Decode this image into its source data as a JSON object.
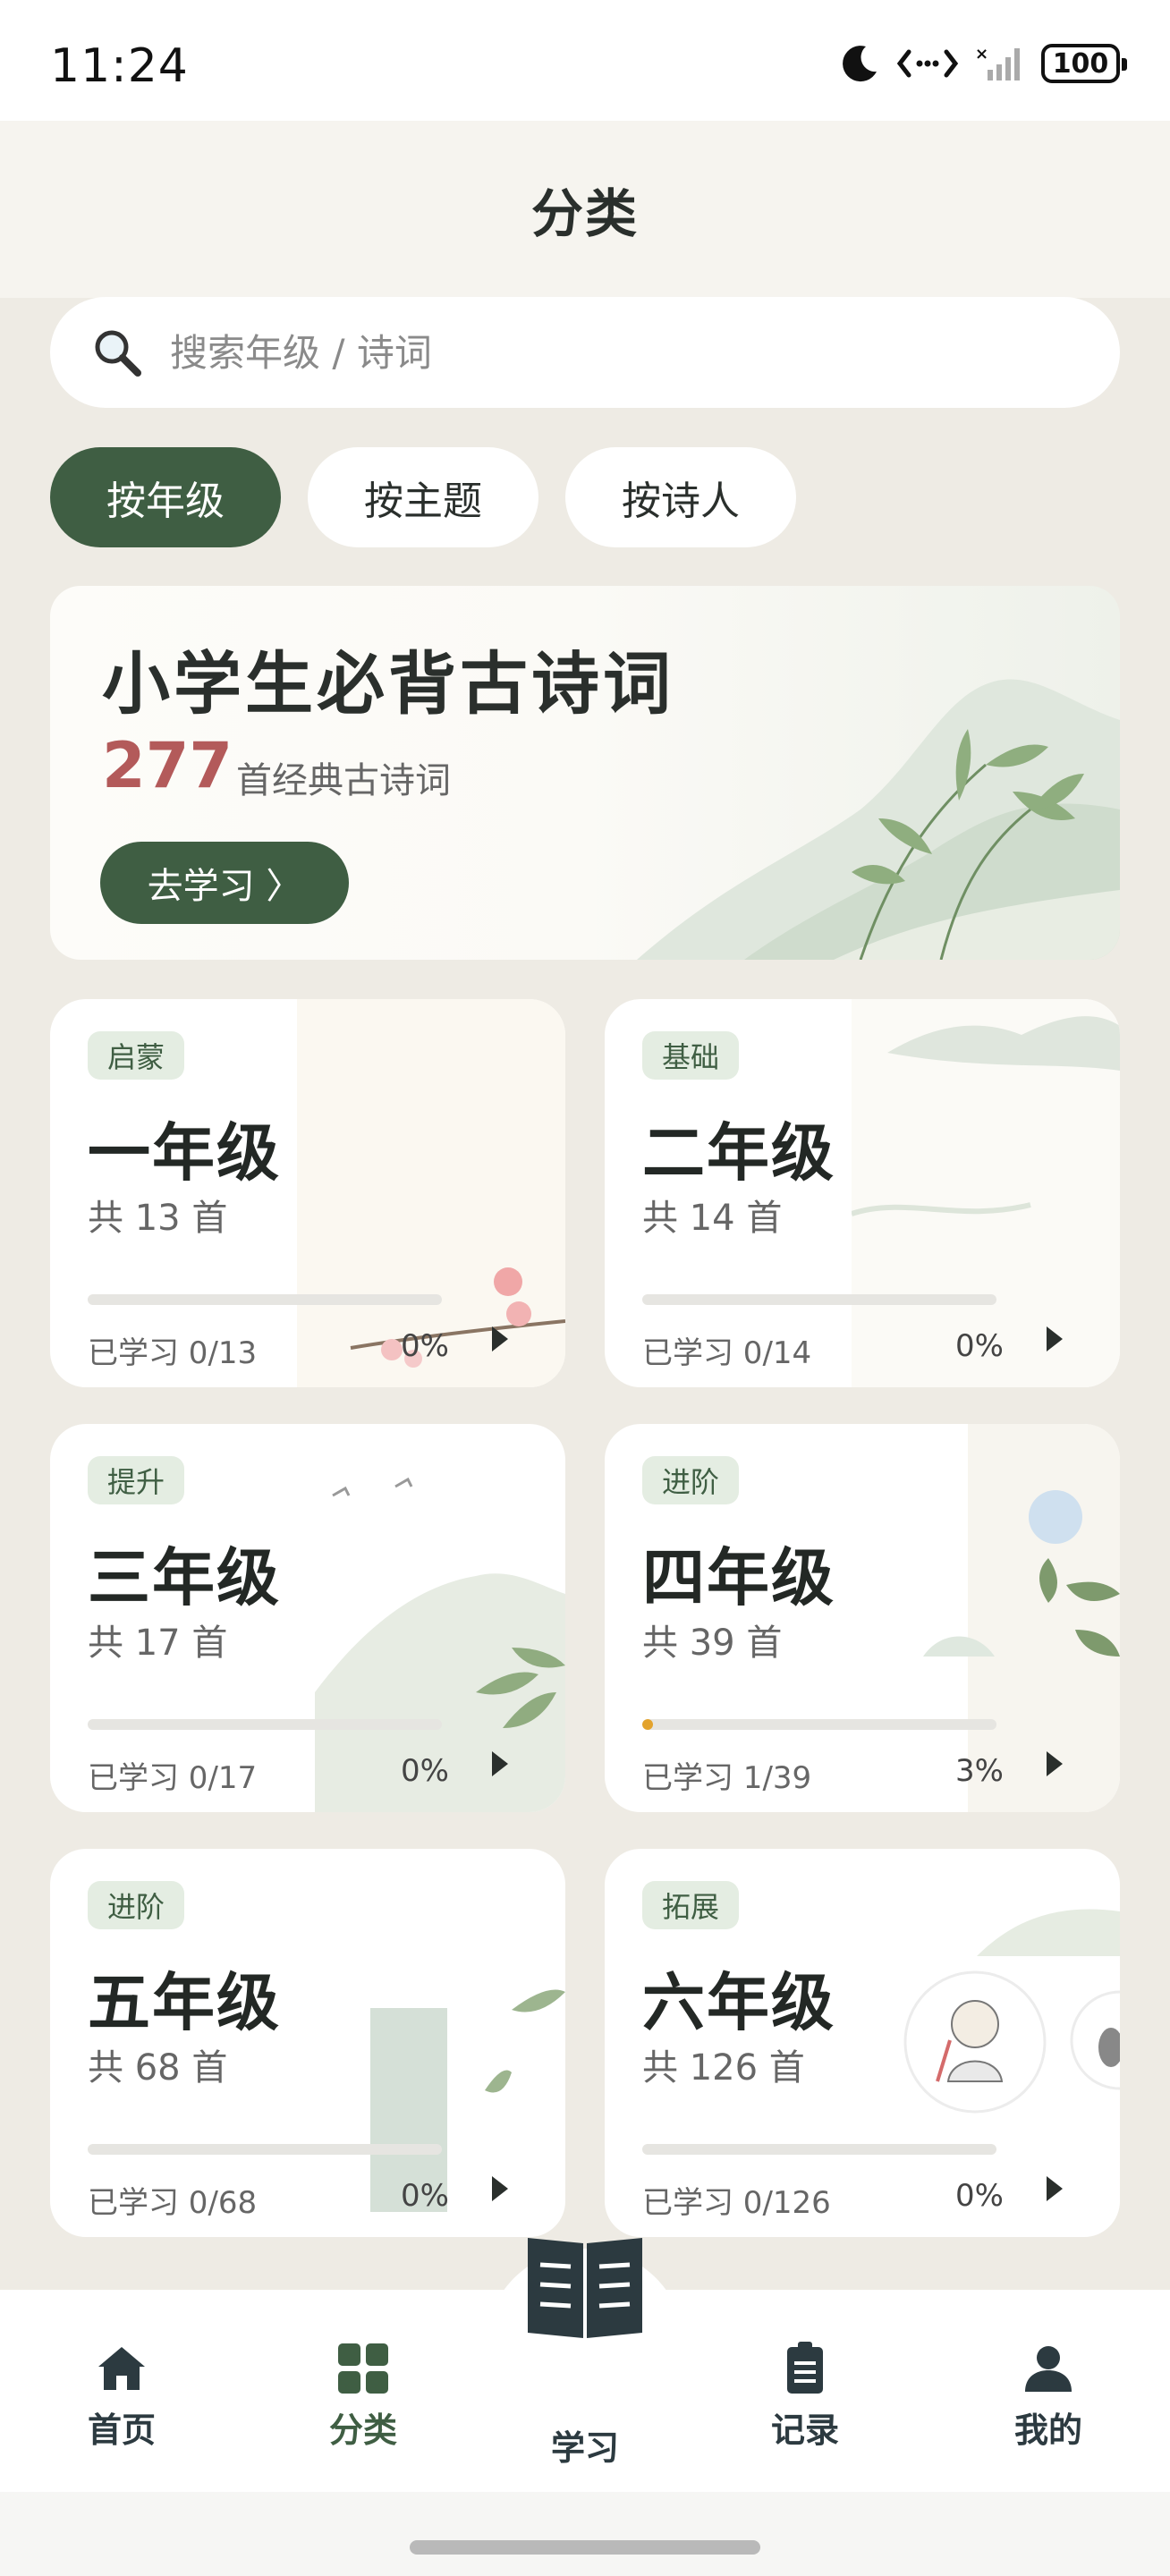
{
  "status_bar": {
    "time": "11:24",
    "battery": "100",
    "icons": [
      "moon-icon",
      "data-transfer-icon",
      "signal-icon",
      "battery-icon"
    ]
  },
  "header": {
    "title": "分类"
  },
  "search": {
    "placeholder": "搜索年级 / 诗词",
    "value": ""
  },
  "filter_tabs": [
    {
      "label": "按年级",
      "active": true
    },
    {
      "label": "按主题",
      "active": false
    },
    {
      "label": "按诗人",
      "active": false
    }
  ],
  "hero": {
    "title": "小学生必背古诗词",
    "count": "277",
    "count_suffix": "首经典古诗词",
    "button_label": "去学习 〉"
  },
  "grades": [
    {
      "tag": "启蒙",
      "name": "一年级",
      "count": "共 13 首",
      "learned": "已学习 0/13",
      "percent": "0%",
      "progress": 0
    },
    {
      "tag": "基础",
      "name": "二年级",
      "count": "共 14 首",
      "learned": "已学习 0/14",
      "percent": "0%",
      "progress": 0
    },
    {
      "tag": "提升",
      "name": "三年级",
      "count": "共 17 首",
      "learned": "已学习 0/17",
      "percent": "0%",
      "progress": 0
    },
    {
      "tag": "进阶",
      "name": "四年级",
      "count": "共 39 首",
      "learned": "已学习 1/39",
      "percent": "3%",
      "progress": 0.03
    },
    {
      "tag": "进阶",
      "name": "五年级",
      "count": "共 68 首",
      "learned": "已学习 0/68",
      "percent": "0%",
      "progress": 0
    },
    {
      "tag": "拓展",
      "name": "六年级",
      "count": "共 126 首",
      "learned": "已学习 0/126",
      "percent": "0%",
      "progress": 0
    }
  ],
  "bottom_nav": {
    "items": [
      {
        "label": "首页",
        "icon": "home-icon",
        "active": false
      },
      {
        "label": "分类",
        "icon": "grid-icon",
        "active": true
      },
      {
        "label": "学习",
        "icon": "book-icon",
        "active": false
      },
      {
        "label": "记录",
        "icon": "clipboard-icon",
        "active": false
      },
      {
        "label": "我的",
        "icon": "person-icon",
        "active": false
      }
    ]
  },
  "colors": {
    "accent": "#3f5e43",
    "highlight": "#b35a5a",
    "progress": "#e3a32d",
    "background": "#eeebe4"
  }
}
